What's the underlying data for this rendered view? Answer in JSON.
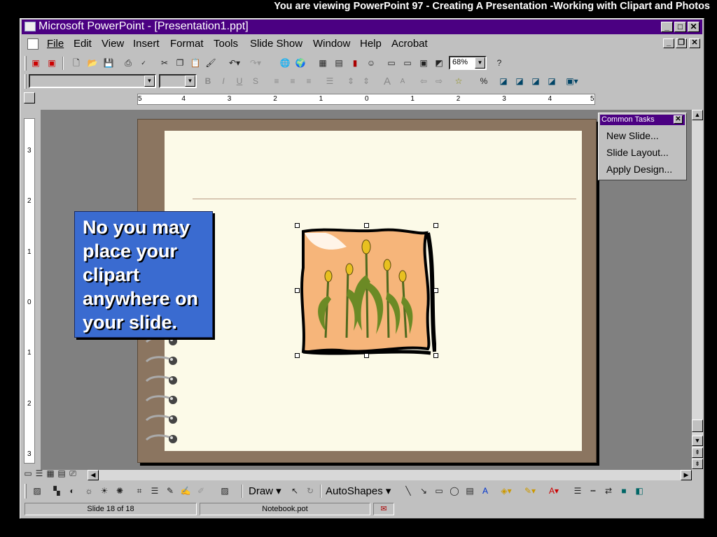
{
  "banner": "You are viewing PowerPoint 97 -  Creating A Presentation -Working with Clipart and Photos",
  "window": {
    "title": "Microsoft PowerPoint - [Presentation1.ppt]"
  },
  "menu": [
    "File",
    "Edit",
    "View",
    "Insert",
    "Format",
    "Tools",
    "Slide Show",
    "Window",
    "Help",
    "Acrobat"
  ],
  "toolbar": {
    "zoom": "68%",
    "font": "",
    "size": ""
  },
  "callout": {
    "text": "No you may place your clipart anywhere on your slide."
  },
  "common_tasks": {
    "title": "Common Tasks",
    "items": [
      "New Slide...",
      "Slide Layout...",
      "Apply Design..."
    ]
  },
  "drawing": {
    "draw_label": "Draw",
    "autoshapes_label": "AutoShapes"
  },
  "status": {
    "slide": "Slide 18 of 18",
    "template": "Notebook.pot"
  },
  "ruler": {
    "h_labels": [
      "5",
      "4",
      "3",
      "2",
      "1",
      "0",
      "1",
      "2",
      "3",
      "4",
      "5"
    ],
    "v_labels": [
      "3",
      "2",
      "1",
      "0",
      "1",
      "2",
      "3"
    ]
  },
  "icons": {
    "accent": "#4b0082",
    "callout_color": "#3a6bd0"
  }
}
